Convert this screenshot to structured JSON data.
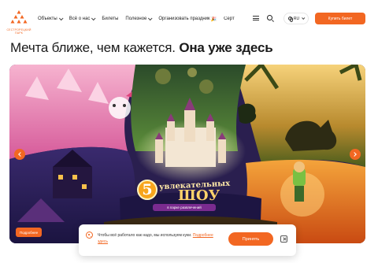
{
  "header": {
    "logo_text": "СЕСТРОРЕЦКИЙ ПАРК",
    "nav": [
      {
        "label": "Объекты",
        "has_dropdown": true
      },
      {
        "label": "Всё о нас",
        "has_dropdown": true
      },
      {
        "label": "Билеты",
        "has_dropdown": false
      },
      {
        "label": "Полезное",
        "has_dropdown": true
      },
      {
        "label": "Организовать праздник",
        "emoji": "🎉",
        "has_dropdown": false
      }
    ],
    "truncated_item": "Серт",
    "menu_icon": "hamburger-icon",
    "search_icon": "search-icon",
    "language": "RU",
    "buy_button": "Купить билет"
  },
  "page": {
    "title_regular": "Мечта ближе, чем кажется.",
    "title_bold": "Она уже здесь"
  },
  "banner": {
    "show_number": "5",
    "show_line1": "увлекательных",
    "show_line2": "ШОУ",
    "show_line3": "в парке развлечений",
    "more_button": "Подробнее"
  },
  "cookie": {
    "text": "Чтобы всё работало как надо, мы используем куки.",
    "link_text": "Подробнее здесь",
    "ok_button": "Принять"
  },
  "colors": {
    "accent": "#f26722"
  }
}
